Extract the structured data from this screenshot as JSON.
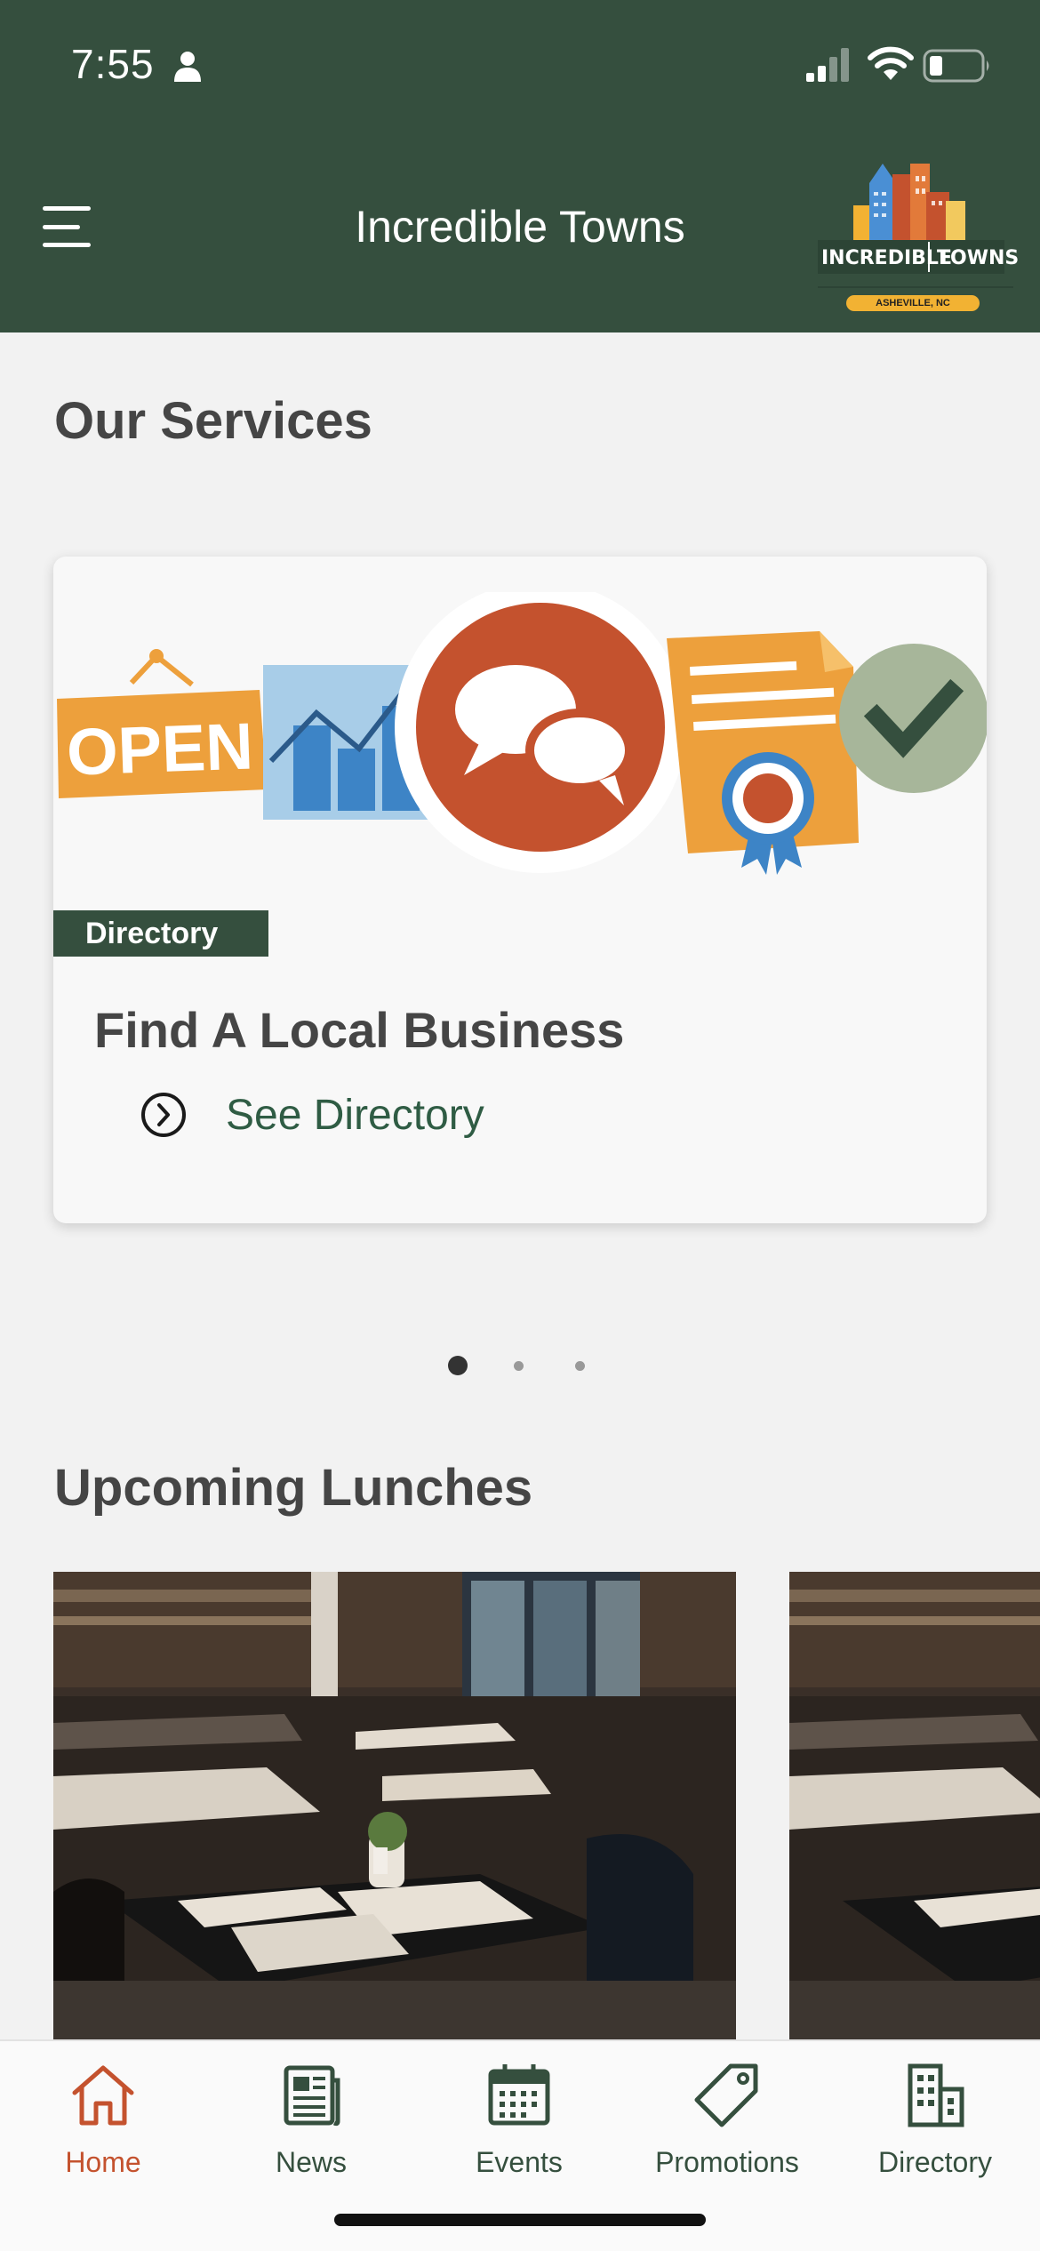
{
  "status_bar": {
    "time": "7:55"
  },
  "header": {
    "title": "Incredible Towns",
    "logo_text_1": "INCREDIBLE",
    "logo_text_2": "TOWNS",
    "logo_city": "ASHEVILLE, NC"
  },
  "services": {
    "title": "Our Services",
    "card": {
      "open_sign": "OPEN",
      "badge": "Directory",
      "headline": "Find A Local Business",
      "link_label": "See Directory"
    },
    "carousel": {
      "page_count": 3,
      "active_index": 0
    }
  },
  "lunches": {
    "title": "Upcoming Lunches"
  },
  "tabbar": {
    "items": [
      {
        "label": "Home",
        "icon": "home-icon",
        "active": true
      },
      {
        "label": "News",
        "icon": "newspaper-icon",
        "active": false
      },
      {
        "label": "Events",
        "icon": "calendar-icon",
        "active": false
      },
      {
        "label": "Promotions",
        "icon": "tag-icon",
        "active": false
      },
      {
        "label": "Directory",
        "icon": "building-icon",
        "active": false
      }
    ]
  },
  "colors": {
    "brand_green": "#354f3e",
    "accent_orange": "#c4522e",
    "link_green": "#2f5c44"
  }
}
